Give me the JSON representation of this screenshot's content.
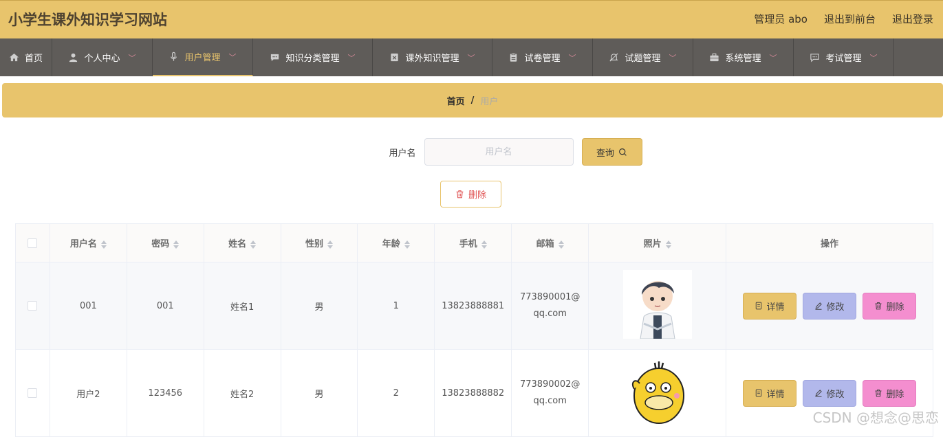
{
  "header": {
    "site_title": "小学生课外知识学习网站",
    "admin_label": "管理员 abo",
    "front_label": "退出到前台",
    "logout_label": "退出登录"
  },
  "nav": {
    "items": [
      {
        "label": "首页",
        "icon": "home-icon"
      },
      {
        "label": "个人中心",
        "icon": "user-icon"
      },
      {
        "label": "用户管理",
        "icon": "microphone-icon"
      },
      {
        "label": "知识分类管理",
        "icon": "chat-icon"
      },
      {
        "label": "课外知识管理",
        "icon": "box-x-icon"
      },
      {
        "label": "试卷管理",
        "icon": "clipboard-icon"
      },
      {
        "label": "试题管理",
        "icon": "bell-off-icon"
      },
      {
        "label": "系统管理",
        "icon": "briefcase-icon"
      },
      {
        "label": "考试管理",
        "icon": "message-icon"
      }
    ],
    "active_color": "#e8c46c"
  },
  "breadcrumb": {
    "home": "首页",
    "separator": "/",
    "current": "用户"
  },
  "search": {
    "label": "用户名",
    "placeholder": "用户名",
    "button_label": "查询"
  },
  "batch_delete_label": "删除",
  "table": {
    "headers": [
      "用户名",
      "密码",
      "姓名",
      "性别",
      "年龄",
      "手机",
      "邮箱",
      "照片",
      "操作"
    ],
    "rows": [
      {
        "username": "001",
        "password": "001",
        "name": "姓名1",
        "gender": "男",
        "age": "1",
        "phone": "13823888881",
        "email_1": "773890001@",
        "email_2": "qq.com"
      },
      {
        "username": "用户2",
        "password": "123456",
        "name": "姓名2",
        "gender": "男",
        "age": "2",
        "phone": "13823888882",
        "email_1": "773890002@",
        "email_2": "qq.com"
      }
    ],
    "actions": {
      "detail": "详情",
      "edit": "修改",
      "delete": "删除"
    }
  },
  "watermark": "CSDN @想念@思恋",
  "colors": {
    "theme": "#e8c46c",
    "nav_bg": "#5f5c59",
    "edit": "#b2b8eb",
    "delete": "#f48ecf"
  }
}
